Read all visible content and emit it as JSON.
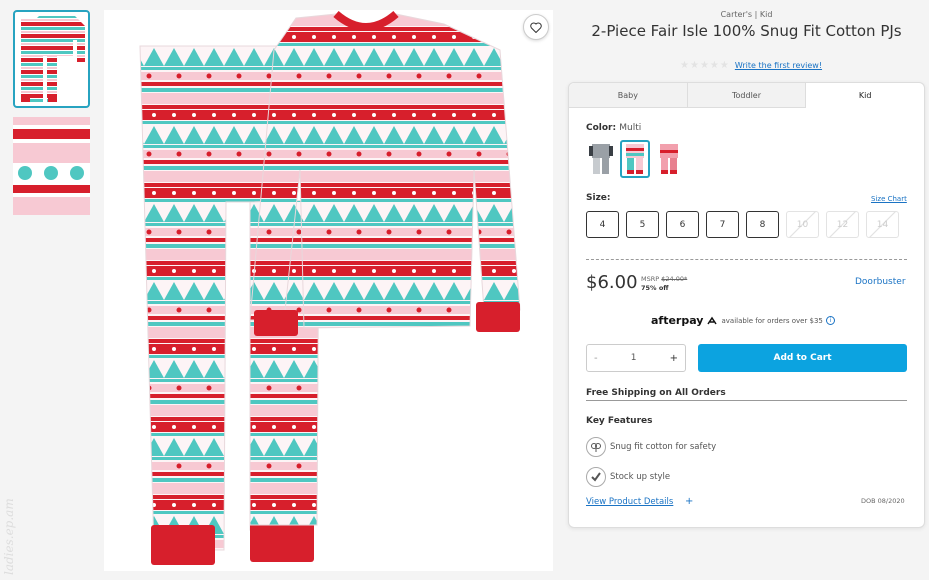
{
  "product": {
    "brand_line": "Carter's | Kid",
    "title": "2-Piece Fair Isle 100% Snug Fit Cotton PJs",
    "review_link": "Write the first review!",
    "rating_stars": 0
  },
  "tabs": [
    {
      "label": "Baby",
      "active": false
    },
    {
      "label": "Toddler",
      "active": false
    },
    {
      "label": "Kid",
      "active": true
    }
  ],
  "color": {
    "label": "Color:",
    "value": "Multi"
  },
  "size": {
    "label": "Size:",
    "chart_link": "Size Chart",
    "options": [
      {
        "label": "4",
        "available": true
      },
      {
        "label": "5",
        "available": true
      },
      {
        "label": "6",
        "available": true
      },
      {
        "label": "7",
        "available": true
      },
      {
        "label": "8",
        "available": true
      },
      {
        "label": "10",
        "available": false
      },
      {
        "label": "12",
        "available": false
      },
      {
        "label": "14",
        "available": false
      }
    ]
  },
  "pricing": {
    "price": "$6.00",
    "msrp_label": "MSRP",
    "msrp_value": "$24.00*",
    "discount": "75% off",
    "promo": "Doorbuster"
  },
  "afterpay": {
    "logo": "afterpay",
    "text": "available for orders over $35",
    "info": "i"
  },
  "quantity": {
    "minus": "-",
    "value": "1",
    "plus": "+"
  },
  "add_to_cart": "Add to Cart",
  "shipping": "Free Shipping on All Orders",
  "key_features": {
    "heading": "Key Features",
    "items": [
      {
        "icon": "cotton-icon",
        "text": "Snug fit cotton for safety"
      },
      {
        "icon": "check-icon",
        "text": "Stock up style"
      }
    ]
  },
  "details_link": "View Product Details",
  "details_plus": "+",
  "dob": "DOB 08/2020",
  "watermark": "ladies.ep.am",
  "colors": {
    "accent": "#27a3c0",
    "link": "#1a73c4",
    "cta": "#0ca3e0",
    "red": "#d71f2c",
    "teal": "#4fc7c1",
    "pink": "#f7c9d3"
  }
}
